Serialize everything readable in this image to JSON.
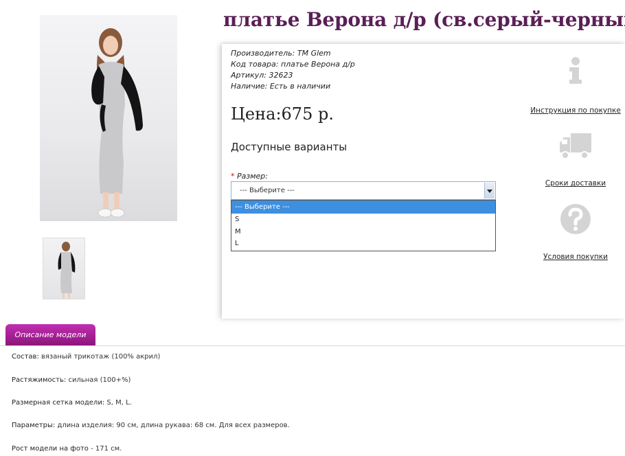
{
  "product": {
    "title": "платье Верона д/р (св.серый-черный)",
    "meta": [
      {
        "key": "Производитель:",
        "value": "ТМ Glem"
      },
      {
        "key": "Код товара:",
        "value": "платье Верона д/р"
      },
      {
        "key": "Артикул:",
        "value": "32623"
      },
      {
        "key": "Наличие:",
        "value": "Есть в наличии"
      }
    ],
    "price": "Цена:675 р.",
    "variants_heading": "Доступные варианты",
    "size_label": "Размер:",
    "required_mark": "*",
    "size_select_value": "--- Выберите ---",
    "size_options": [
      "--- Выберите ---",
      "S",
      "M",
      "L"
    ]
  },
  "sidebar": {
    "links": [
      {
        "label": "Инструкция по покупке",
        "icon": "info-icon"
      },
      {
        "label": "Сроки доставки",
        "icon": "truck-icon"
      },
      {
        "label": "Условия покупки",
        "icon": "question-icon"
      }
    ]
  },
  "tabs": {
    "description_label": "Описание модели"
  },
  "description": [
    {
      "key": "Состав:",
      "value": " вязаный трикотаж (100% акрил)"
    },
    {
      "key": "Растяжимость:",
      "value": " сильная (100+%)"
    },
    {
      "key": "Размерная сетка модели:",
      "value": " S, M, L."
    },
    {
      "key": "Параметры:",
      "value": " длина изделия: 90 см, длина рукава: 68 см. Для всех размеров."
    },
    {
      "key": "Рост модели на фото",
      "value": " - 171 см."
    }
  ],
  "colors": {
    "title": "#5a1f56",
    "tab": "#a0208f",
    "select_highlight": "#3d8fe0",
    "icon_gray": "#d4d4d4"
  }
}
